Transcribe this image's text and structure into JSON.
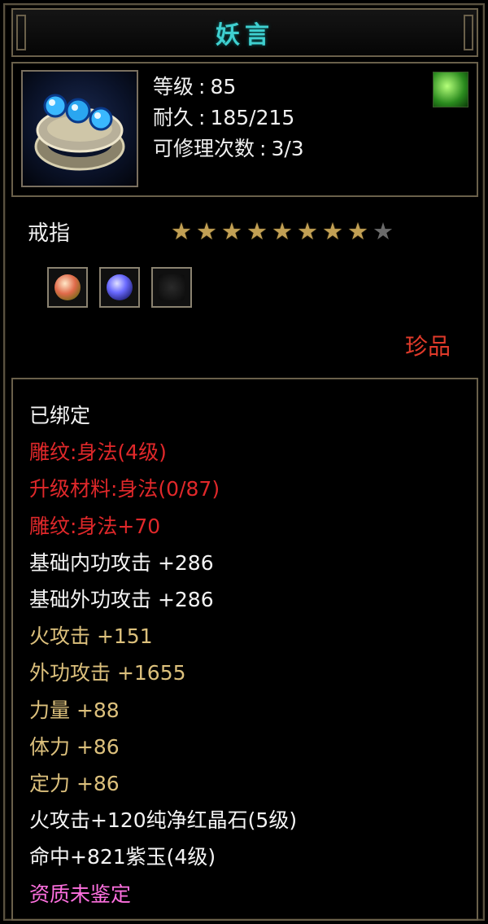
{
  "item": {
    "name": "妖言",
    "category": "戒指",
    "rarity": "珍品",
    "stats": [
      {
        "label": "等级",
        "value": "85"
      },
      {
        "label": "耐久",
        "value": "185/215"
      },
      {
        "label": "可修理次数",
        "value": "3/3"
      }
    ],
    "stars": {
      "filled": 8,
      "total": 9
    },
    "sockets": [
      {
        "gem": "red-gem-icon"
      },
      {
        "gem": "purple-gem-icon"
      },
      {
        "gem": "empty-socket-icon"
      }
    ]
  },
  "attributes": [
    {
      "text": "已绑定",
      "color": "#f4f4f4"
    },
    {
      "text": "雕纹:身法(4级)",
      "color": "#e0282a"
    },
    {
      "text": "升级材料:身法(0/87)",
      "color": "#e0282a"
    },
    {
      "text": "雕纹:身法+70",
      "color": "#e0282a"
    },
    {
      "text": "基础内功攻击 +286",
      "color": "#f4f4f4"
    },
    {
      "text": "基础外功攻击 +286",
      "color": "#f4f4f4"
    },
    {
      "text": "火攻击 +151",
      "color": "#dcc07c"
    },
    {
      "text": "外功攻击 +1655",
      "color": "#dcc07c"
    },
    {
      "text": "力量 +88",
      "color": "#dcc07c"
    },
    {
      "text": "体力 +86",
      "color": "#dcc07c"
    },
    {
      "text": "定力 +86",
      "color": "#dcc07c"
    },
    {
      "text": "火攻击+120纯净红晶石(5级)",
      "color": "#f4f4f4"
    },
    {
      "text": "命中+821紫玉(4级)",
      "color": "#f4f4f4"
    },
    {
      "text": "资质未鉴定",
      "color": "#ff70e0"
    }
  ]
}
